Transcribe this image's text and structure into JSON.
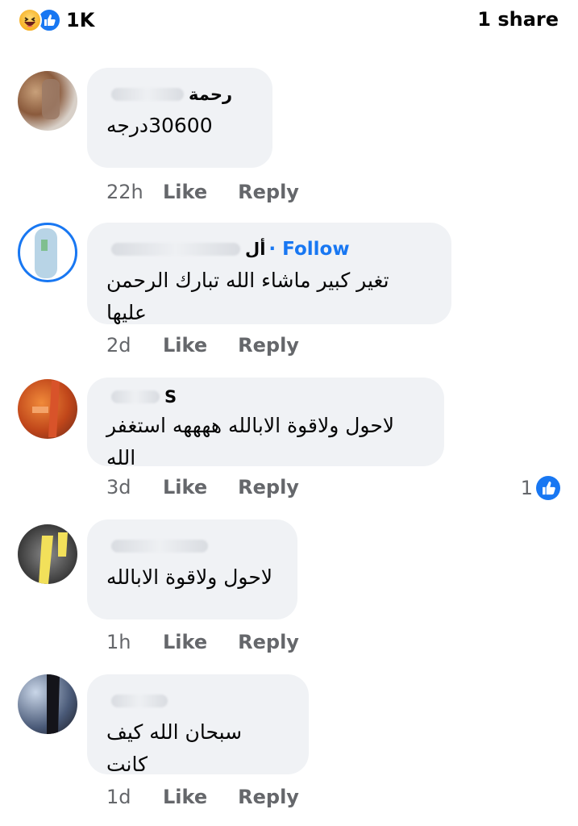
{
  "post_stats": {
    "reaction_count": "1K",
    "share_label": "1 share",
    "reaction_icons": [
      "haha-icon",
      "like-icon"
    ],
    "colors": {
      "like": "#1877f2",
      "haha": "#f7b125"
    }
  },
  "comments": [
    {
      "author": "رحمة",
      "text": "30600درجه",
      "time": "22h",
      "like_label": "Like",
      "reply_label": "Reply"
    },
    {
      "author": "أل",
      "follow_label": "· Follow",
      "text": "تغير كبير ماشاء الله تبارك الرحمن عليها",
      "time": "2d",
      "like_label": "Like",
      "reply_label": "Reply"
    },
    {
      "author": "S",
      "text": "لاحول ولاقوة الابالله ههههه استغفر الله",
      "time": "3d",
      "like_label": "Like",
      "reply_label": "Reply",
      "reaction_count": "1"
    },
    {
      "author": "",
      "text": "لاحول ولاقوة الابالله",
      "time": "1h",
      "like_label": "Like",
      "reply_label": "Reply"
    },
    {
      "author": "",
      "text": "سبحان الله كيف كانت",
      "time": "1d",
      "like_label": "Like",
      "reply_label": "Reply"
    }
  ]
}
